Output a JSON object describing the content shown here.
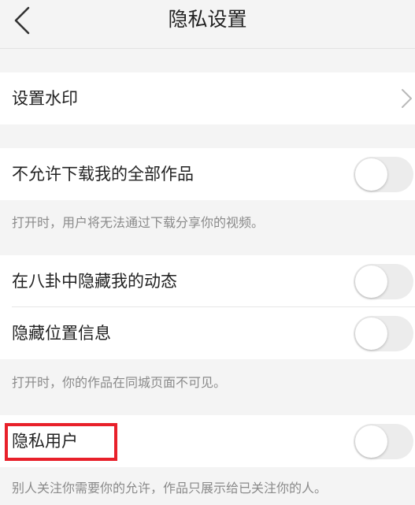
{
  "header": {
    "title": "隐私设置",
    "back_icon": "chevron-left-icon"
  },
  "watermark_row": {
    "label": "设置水印",
    "icon": "chevron-right-icon"
  },
  "download_row": {
    "label": "不允许下载我的全部作品",
    "enabled": false,
    "note": "打开时，用户将无法通过下载分享你的视频。"
  },
  "gossip_row": {
    "label": "在八卦中隐藏我的动态",
    "enabled": false
  },
  "location_row": {
    "label": "隐藏位置信息",
    "enabled": false,
    "note": "打开时，你的作品在同城页面不可见。"
  },
  "private_row": {
    "label": "隐私用户",
    "enabled": false,
    "note": "别人关注你需要你的允许，作品只展示给已关注你的人。"
  },
  "colors": {
    "background": "#f4f4f4",
    "row_background": "#ffffff",
    "toggle_off": "#ececec",
    "note_text": "#8a8a8a",
    "highlight": "#e8202a"
  }
}
